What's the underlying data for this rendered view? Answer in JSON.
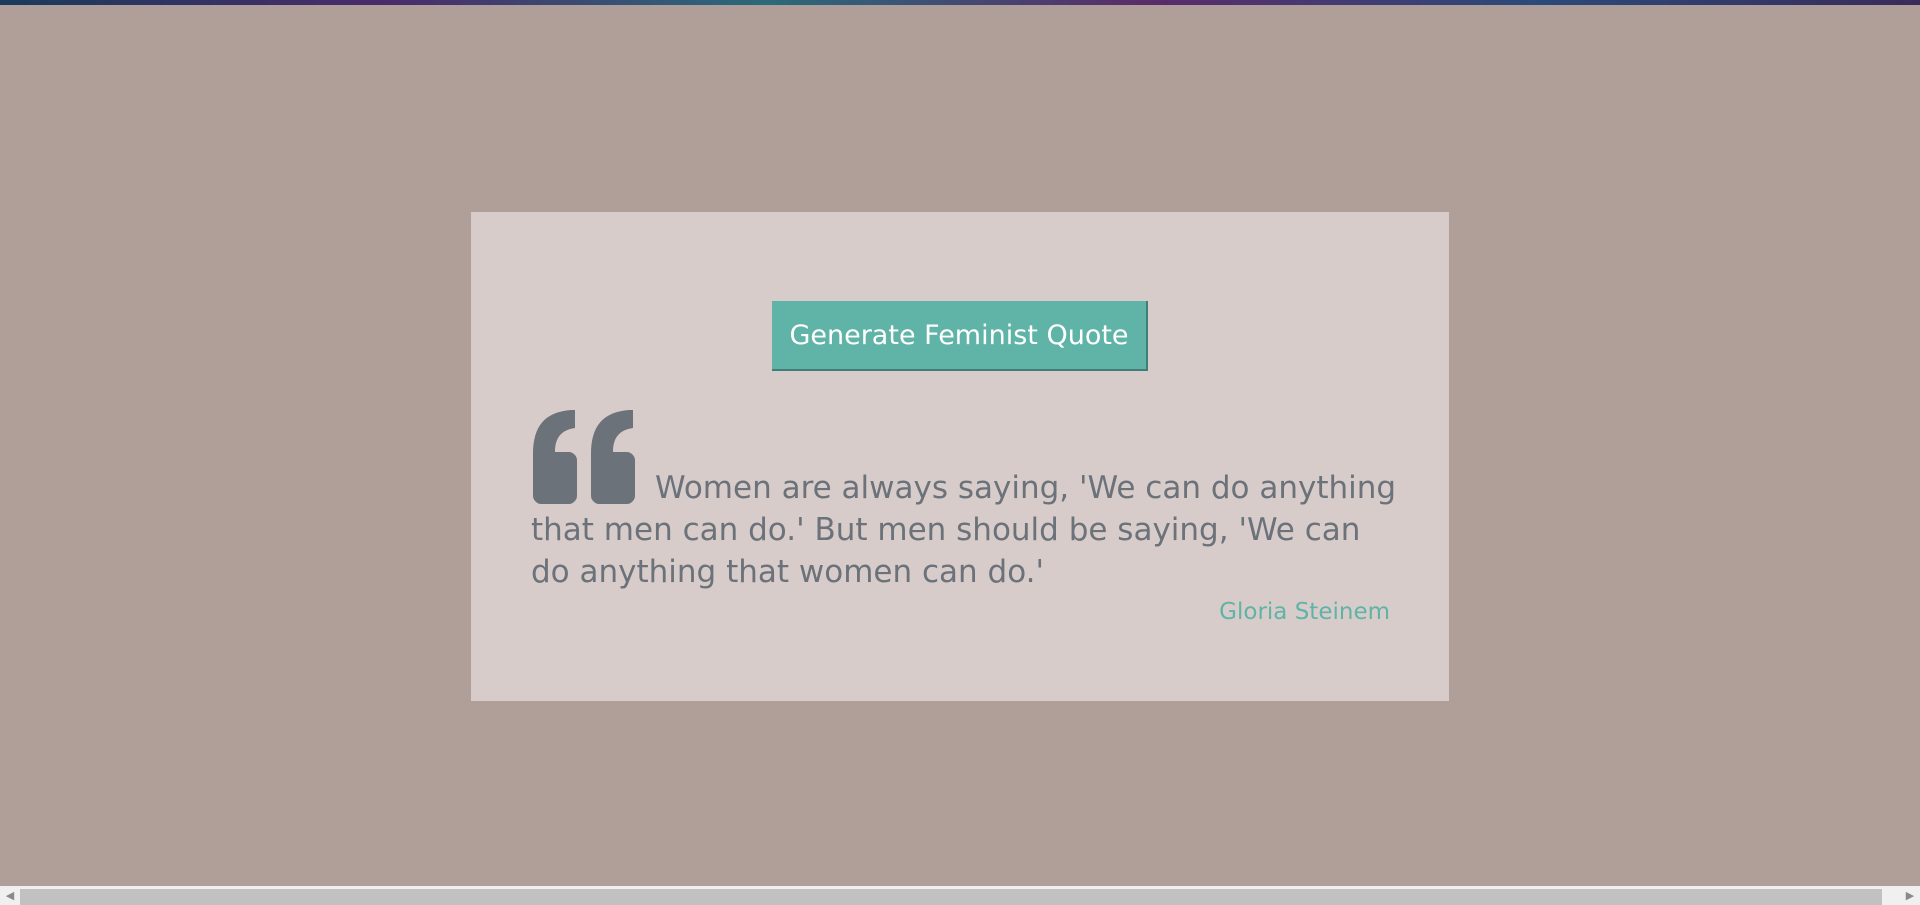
{
  "button": {
    "label": "Generate Feminist Quote"
  },
  "quote": {
    "text": "Women are always saying, 'We can do anything that men can do.' But men should be saying, 'We can do anything that women can do.'",
    "author": "Gloria Steinem",
    "icon": "quote-left-icon"
  },
  "colors": {
    "background": "#b09f98",
    "card": "#d8ccca",
    "accent": "#5fb3a7",
    "text": "#6b727a"
  },
  "scrollbar": {
    "left_arrow": "◀",
    "right_arrow": "▶"
  }
}
